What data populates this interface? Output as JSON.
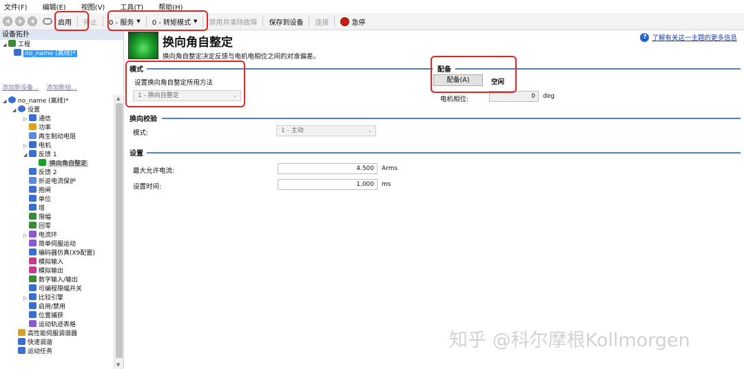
{
  "menu": [
    "文件(F)",
    "编辑(E)",
    "视图(V)",
    "工具(T)",
    "帮助(H)"
  ],
  "toolbar": {
    "enable": "启用",
    "disable": "停止",
    "service_mode": "0 - 服务",
    "torque_mode": "0 - 转矩模式",
    "clear_faults": "禁用并清除故障",
    "save_to_device": "保存到设备",
    "connect": "连接",
    "estop": "急停"
  },
  "device_topology": {
    "title": "设备拓扑",
    "project": "工程",
    "device": "no_name (离线)*",
    "links": [
      "添加新设备...",
      "添加新组..."
    ]
  },
  "tree": {
    "root": "no_name (离线)*",
    "settings": "设置",
    "items": [
      {
        "label": "通信",
        "level": 2,
        "expander": "▷",
        "icon": "comm-icon",
        "color": "#3a6fd0"
      },
      {
        "label": "功率",
        "level": 2,
        "expander": "",
        "icon": "power-icon",
        "color": "#e0a020"
      },
      {
        "label": "再生制动电阻",
        "level": 2,
        "expander": "",
        "icon": "regen-icon",
        "color": "#5a8ad8"
      },
      {
        "label": "电机",
        "level": 2,
        "expander": "▷",
        "icon": "motor-icon",
        "color": "#3a6fd0"
      },
      {
        "label": "反馈 1",
        "level": 2,
        "expander": "◢",
        "icon": "feedback-icon",
        "color": "#3a6fd0"
      },
      {
        "label": "换向角自整定",
        "level": 3,
        "expander": "",
        "icon": "commutation-icon",
        "color": "#1c9e2a",
        "selected": true
      },
      {
        "label": "反馈 2",
        "level": 2,
        "expander": "",
        "icon": "feedback2-icon",
        "color": "#3a6fd0"
      },
      {
        "label": "折返电流保护",
        "level": 2,
        "expander": "",
        "icon": "foldback-icon",
        "color": "#5a8ad8"
      },
      {
        "label": "抱闸",
        "level": 2,
        "expander": "",
        "icon": "brake-icon",
        "color": "#3a6fd0"
      },
      {
        "label": "单位",
        "level": 2,
        "expander": "",
        "icon": "units-icon",
        "color": "#3a6fd0"
      },
      {
        "label": "增",
        "level": 2,
        "expander": "",
        "icon": "gain-icon",
        "color": "#3a6fd0"
      },
      {
        "label": "限幅",
        "level": 2,
        "expander": "",
        "icon": "limits-icon",
        "color": "#3a8a3a"
      },
      {
        "label": "回零",
        "level": 2,
        "expander": "",
        "icon": "homing-icon",
        "color": "#3a8a3a"
      },
      {
        "label": "电流环",
        "level": 2,
        "expander": "▷",
        "icon": "current-loop-icon",
        "color": "#8a5ad0"
      },
      {
        "label": "简单伺服运动",
        "level": 2,
        "expander": "",
        "icon": "servo-motion-icon",
        "color": "#8a5ad0"
      },
      {
        "label": "编码器仿真(X9配置)",
        "level": 2,
        "expander": "",
        "icon": "encoder-emulation-icon",
        "color": "#3a6fd0"
      },
      {
        "label": "模拟输入",
        "level": 2,
        "expander": "",
        "icon": "analog-in-icon",
        "color": "#c83a8a"
      },
      {
        "label": "模拟输出",
        "level": 2,
        "expander": "",
        "icon": "analog-out-icon",
        "color": "#c83a8a"
      },
      {
        "label": "数字输入/输出",
        "level": 2,
        "expander": "",
        "icon": "digital-io-icon",
        "color": "#3a8a3a"
      },
      {
        "label": "可编程限幅开关",
        "level": 2,
        "expander": "",
        "icon": "limit-switch-icon",
        "color": "#3a6fd0"
      },
      {
        "label": "比较引擎",
        "level": 2,
        "expander": "▷",
        "icon": "compare-icon",
        "color": "#3a6fd0"
      },
      {
        "label": "启用/禁用",
        "level": 2,
        "expander": "",
        "icon": "enable-disable-icon",
        "color": "#3a6fd0"
      },
      {
        "label": "位置捕获",
        "level": 2,
        "expander": "",
        "icon": "capture-icon",
        "color": "#3a6fd0"
      },
      {
        "label": "运动轨迹表格",
        "level": 2,
        "expander": "",
        "icon": "motion-table-icon",
        "color": "#8a5ad0"
      },
      {
        "label": "高性能伺服调谐器",
        "level": 1,
        "expander": "",
        "icon": "tuner-icon",
        "color": "#d0a030"
      },
      {
        "label": "快速调谐",
        "level": 1,
        "expander": "",
        "icon": "quick-tune-icon",
        "color": "#3a6fd0"
      },
      {
        "label": "运动任务",
        "level": 1,
        "expander": "",
        "icon": "motion-task-icon",
        "color": "#3a6fd0"
      }
    ]
  },
  "page": {
    "title": "换向角自整定",
    "description": "换向角自整定决定反馈与电机电相位之间的对准偏差。",
    "help_link": "了解有关这一主题的更多信息",
    "mode_section": {
      "title": "模式",
      "method_label": "设置换向角自整定所用方法",
      "method_value": "1 - 换向自整定"
    },
    "align_section": {
      "title": "配备",
      "align_button": "配备(A)",
      "status": "空闲",
      "phase_label": "电机相位:",
      "phase_value": "0",
      "phase_unit": "deg"
    },
    "verify_section": {
      "title": "换向校验",
      "mode_label": "模式:",
      "mode_value": "1 - 主动"
    },
    "settings_section": {
      "title": "设置",
      "max_current_label": "最大允许电流:",
      "max_current_value": "4.500",
      "max_current_unit": "Arms",
      "time_label": "设置时间:",
      "time_value": "1,000",
      "time_unit": "ms"
    }
  },
  "watermark": "知乎 @科尔摩根Kollmorgen",
  "colors": {
    "highlight": "#e52222",
    "section_line": "#4c7fc3",
    "selection": "#3399ff",
    "link": "#1a3caa"
  }
}
